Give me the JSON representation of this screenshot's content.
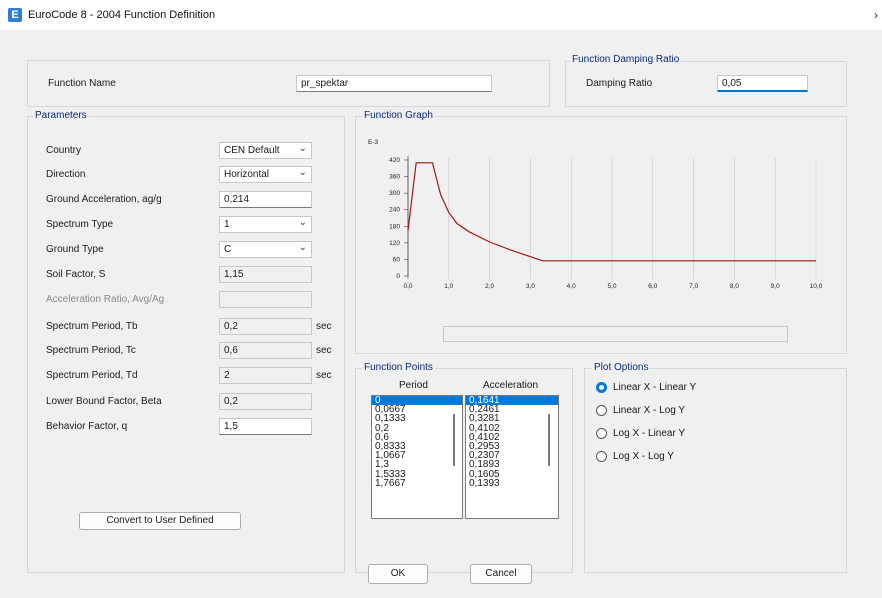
{
  "window": {
    "title": "EuroCode 8 - 2004 Function Definition",
    "icon": "E",
    "close_glyph": "›"
  },
  "function_name": {
    "label": "Function Name",
    "value": "pr_spektar"
  },
  "damping": {
    "group_title": "Function Damping Ratio",
    "label": "Damping Ratio",
    "value": "0,05"
  },
  "parameters": {
    "group_title": "Parameters",
    "country": {
      "label": "Country",
      "value": "CEN Default"
    },
    "direction": {
      "label": "Direction",
      "value": "Horizontal"
    },
    "ground_acceleration": {
      "label": "Ground Acceleration, ag/g",
      "value": "0,214"
    },
    "spectrum_type": {
      "label": "Spectrum Type",
      "value": "1"
    },
    "ground_type": {
      "label": "Ground Type",
      "value": "C"
    },
    "soil_factor": {
      "label": "Soil Factor, S",
      "value": "1,15"
    },
    "acceleration_ratio": {
      "label": "Acceleration Ratio, Avg/Ag",
      "value": ""
    },
    "tb": {
      "label": "Spectrum Period, Tb",
      "value": "0,2",
      "unit": "sec"
    },
    "tc": {
      "label": "Spectrum Period, Tc",
      "value": "0,6",
      "unit": "sec"
    },
    "td": {
      "label": "Spectrum Period, Td",
      "value": "2",
      "unit": "sec"
    },
    "beta": {
      "label": "Lower Bound Factor, Beta",
      "value": "0,2"
    },
    "q": {
      "label": "Behavior Factor, q",
      "value": "1,5"
    },
    "convert_button": "Convert to User Defined"
  },
  "graph": {
    "group_title": "Function Graph",
    "status_value": "",
    "chart_data": {
      "type": "line",
      "y_multiplier_label": "E-3",
      "x_ticks": [
        "0,0",
        "1,0",
        "2,0",
        "3,0",
        "4,0",
        "5,0",
        "6,0",
        "7,0",
        "8,0",
        "9,0",
        "10,0"
      ],
      "y_ticks": [
        "0",
        "60",
        "120",
        "180",
        "240",
        "300",
        "360",
        "420"
      ],
      "xlim": [
        0,
        10
      ],
      "ylim": [
        0,
        420
      ],
      "line_color": "#a01818",
      "series": [
        {
          "x": [
            0,
            0.2,
            0.6,
            0.8,
            1.0,
            1.2,
            1.5,
            2.0,
            2.5,
            3.0,
            3.3,
            4.0,
            10.0
          ],
          "y": [
            164,
            410,
            410,
            295,
            230,
            190,
            160,
            123,
            95,
            70,
            55,
            55,
            55
          ]
        }
      ]
    }
  },
  "function_points": {
    "group_title": "Function Points",
    "period_header": "Period",
    "acceleration_header": "Acceleration",
    "periods": [
      "0",
      "0,0667",
      "0,1333",
      "0,2",
      "0,6",
      "0,8333",
      "1,0667",
      "1,3",
      "1,5333",
      "1,7667"
    ],
    "accelerations": [
      "0,1641",
      "0,2461",
      "0,3281",
      "0,4102",
      "0,4102",
      "0,2953",
      "0,2307",
      "0,1893",
      "0,1605",
      "0,1393"
    ]
  },
  "plot_options": {
    "group_title": "Plot Options",
    "options": [
      "Linear X - Linear Y",
      "Linear X - Log Y",
      "Log X - Linear Y",
      "Log X - Log Y"
    ],
    "selected": 0
  },
  "buttons": {
    "ok": "OK",
    "cancel": "Cancel"
  },
  "colors": {
    "selection": "#0078d7",
    "accent_title": "#0a2a7a",
    "curve": "#a01818",
    "dialog_bg": "#f0f0f0"
  }
}
